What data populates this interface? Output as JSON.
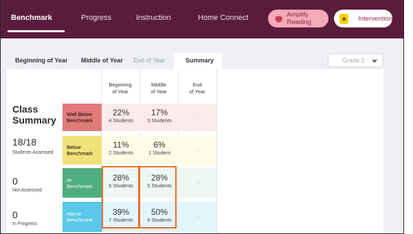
{
  "nav": {
    "tabs": [
      "Benchmark",
      "Progress",
      "Instruction",
      "Home Connect"
    ],
    "active": "Benchmark",
    "amplify_label": "Amplify Reading",
    "intervention_badge": "a",
    "intervention_label": "Intervention"
  },
  "subtabs": [
    "Beginning of Year",
    "Middle of Year",
    "End of Year",
    "Summary"
  ],
  "active_subtab": "Summary",
  "grade_select": "Grade 1",
  "table": {
    "columns": [
      {
        "line1": "Beginning",
        "line2": "of Year"
      },
      {
        "line1": "Middle",
        "line2": "of Year"
      },
      {
        "line1": "End",
        "line2": "of Year"
      }
    ],
    "summary": {
      "title_line1": "Class",
      "title_line2": "Summary",
      "assessed_value": "18/18",
      "assessed_label": "Students Assessed",
      "not_assessed_value": "0",
      "not_assessed_label": "Not Assessed",
      "in_progress_value": "0",
      "in_progress_label": "In Progress"
    },
    "rows": [
      {
        "band_line1": "Well Below",
        "band_line2": "Benchmark",
        "band_color": "#e07a78",
        "bg": "#fbeaea",
        "boy_pct": "22%",
        "boy_cnt": "4 Students",
        "moy_pct": "17%",
        "moy_cnt": "3 Students",
        "eoy": "-"
      },
      {
        "band_line1": "Below",
        "band_line2": "Benchmark",
        "band_color": "#f2e27a",
        "bg": "#fdfbe6",
        "boy_pct": "11%",
        "boy_cnt": "2 Students",
        "moy_pct": "6%",
        "moy_cnt": "1 Student",
        "eoy": "-"
      },
      {
        "band_line1": "At",
        "band_line2": "Benchmark",
        "band_color": "#4fae7f",
        "bg": "#eef7f1",
        "boy_pct": "28%",
        "boy_cnt": "5 Students",
        "moy_pct": "28%",
        "moy_cnt": "5 Students",
        "eoy": "-"
      },
      {
        "band_line1": "Above",
        "band_line2": "Benchmark",
        "band_color": "#5ac8e8",
        "bg": "#e3f5fb",
        "boy_pct": "39%",
        "boy_cnt": "7 Students",
        "moy_pct": "50%",
        "moy_cnt": "9 Students",
        "eoy": "-"
      }
    ]
  },
  "colors": {
    "nav_bg": "#5a1c3d",
    "highlight": "#ea6b2a",
    "content_bg": "#eef0f3"
  }
}
